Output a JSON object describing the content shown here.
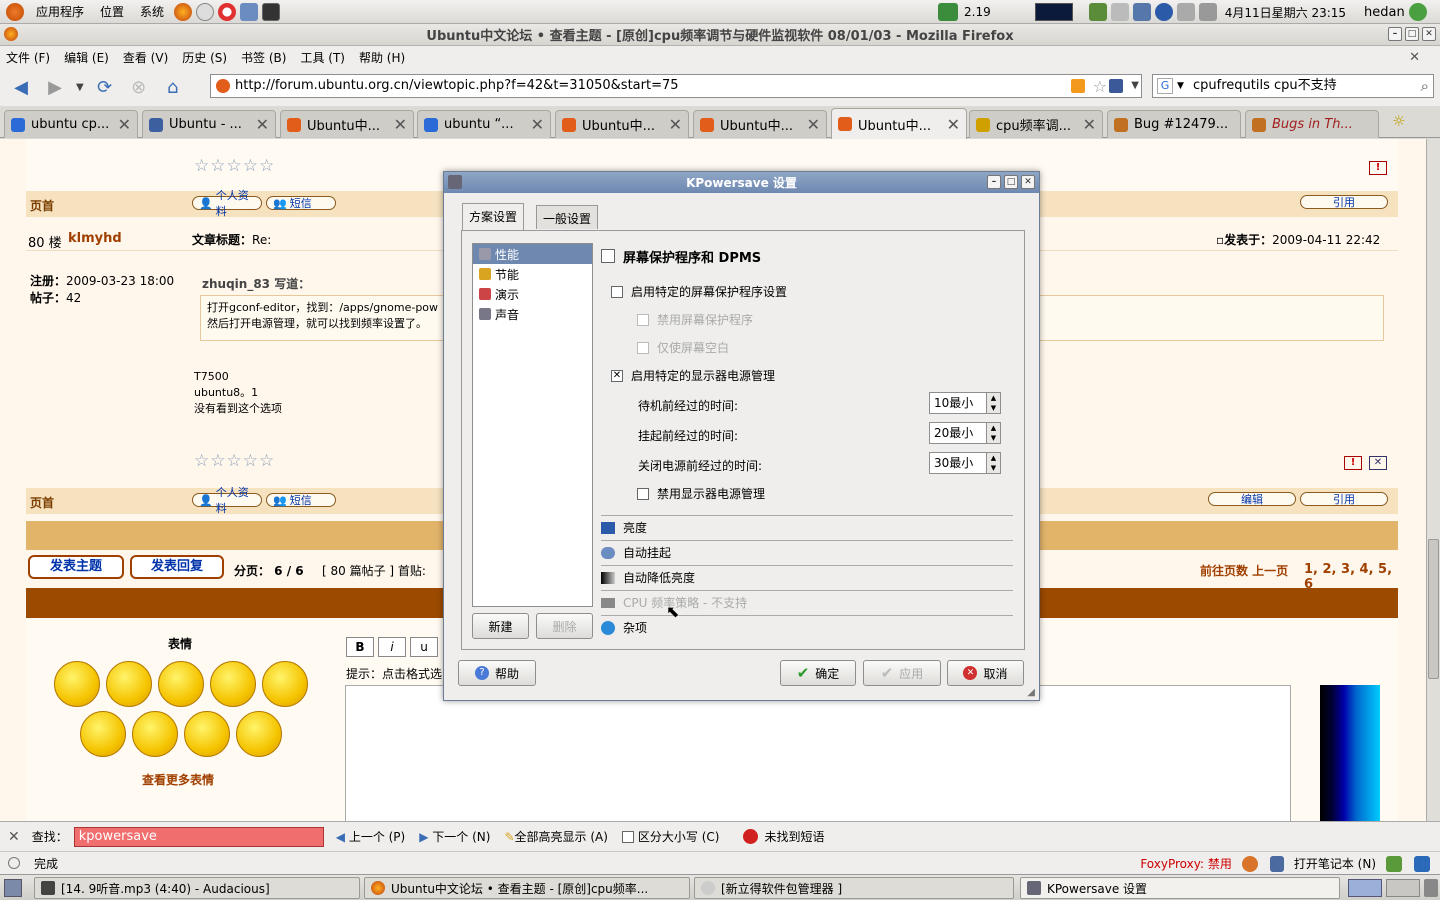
{
  "top_panel": {
    "menus": [
      "应用程序",
      "位置",
      "系统"
    ],
    "battery": "2.19",
    "clock": "4月11日星期六 23:15",
    "user": "hedan"
  },
  "firefox": {
    "title": "Ubuntu中文论坛 • 查看主题 - [原创]cpu频率调节与硬件监视软件 08/01/03 - Mozilla Firefox",
    "menu": [
      "文件 (F)",
      "编辑 (E)",
      "查看 (V)",
      "历史 (S)",
      "书签 (B)",
      "工具 (T)",
      "帮助 (H)"
    ],
    "url": "http://forum.ubuntu.org.cn/viewtopic.php?f=42&t=31050&start=75",
    "search": "cpufrequtils cpu不支持",
    "tabs": [
      {
        "label": "ubuntu cp...",
        "fav": "#2a6bd8"
      },
      {
        "label": "Ubuntu - ...",
        "fav": "#3c5fa0"
      },
      {
        "label": "Ubuntu中...",
        "fav": "#e25c1a"
      },
      {
        "label": "ubuntu “...",
        "fav": "#2a6bd8"
      },
      {
        "label": "Ubuntu中...",
        "fav": "#e25c1a"
      },
      {
        "label": "Ubuntu中...",
        "fav": "#e25c1a"
      },
      {
        "label": "Ubuntu中...",
        "fav": "#e25c1a"
      },
      {
        "label": "cpu频率调...",
        "fav": "#d0a000"
      },
      {
        "label": "Bug #12479...",
        "fav": "#c07020"
      },
      {
        "label": "Bugs in Th...",
        "fav": "#c07020"
      }
    ]
  },
  "forum": {
    "top_label": "页首",
    "profile_btn": "个人资料",
    "pm_btn": "短信",
    "quote_btn": "引用",
    "edit_btn": "编辑",
    "post_no": "80 楼",
    "author": "klmyhd",
    "subject_label": "文章标题：",
    "subject": "Re:",
    "posted_label": "发表于：",
    "posted": "2009-04-11 22:42",
    "reg_label": "注册：",
    "reg": "2009-03-23 18:00",
    "posts_label": "帖子：",
    "posts": "42",
    "quote_author": "zhuqin_83 写道：",
    "quote_line1": "打开gconf-editor，找到：/apps/gnome-pow",
    "quote_line2": "然后打开电源管理，就可以找到频率设置了。",
    "body1": "T7500",
    "body2": "ubuntu8。1",
    "body3": "没有看到这个选项",
    "new_topic": "发表主题",
    "reply": "发表回复",
    "pagination": "分页： 6 / 6",
    "post_count": "[ 80 篇帖子 ] 首贴:",
    "goto": "前往页数 上一页",
    "pages": "1, 2, 3, 4, 5, 6",
    "smilies_title": "表情",
    "more_smilies": "查看更多表情",
    "fmt_b": "B",
    "fmt_i": "i",
    "fmt_u": "u",
    "hint": "提示：点击格式选"
  },
  "dialog": {
    "title": "KPowersave 设置",
    "tabs": [
      "方案设置",
      "一般设置"
    ],
    "schemes": [
      "性能",
      "节能",
      "演示",
      "声音"
    ],
    "new_btn": "新建",
    "delete_btn": "删除",
    "section_title": "屏幕保护程序和 DPMS",
    "opt_screensaver": "启用特定的屏幕保护程序设置",
    "opt_disable_ss": "禁用屏幕保护程序",
    "opt_blank": "仅使屏幕空白",
    "opt_dpms": "启用特定的显示器电源管理",
    "standby_label": "待机前经过的时间:",
    "standby_val": "10最小",
    "suspend_label": "挂起前经过的时间:",
    "suspend_val": "20最小",
    "off_label": "关闭电源前经过的时间:",
    "off_val": "30最小",
    "opt_disable_dpms": "禁用显示器电源管理",
    "sections": [
      "亮度",
      "自动挂起",
      "自动降低亮度",
      "CPU 频率策略 - 不支持",
      "杂项"
    ],
    "help_btn": "帮助",
    "ok_btn": "确定",
    "apply_btn": "应用",
    "cancel_btn": "取消"
  },
  "findbar": {
    "label": "查找：",
    "value": "kpowersave",
    "prev": "上一个 (P)",
    "next": "下一个 (N)",
    "highlight": "全部高亮显示 (A)",
    "case": "区分大小写 (C)",
    "not_found": "未找到短语"
  },
  "status": {
    "text": "完成",
    "foxy": "FoxyProxy: 禁用",
    "notebook": "打开笔记本 (N)"
  },
  "taskbar": [
    "[14. 9听音.mp3 (4:40) - Audacious]",
    "Ubuntu中文论坛 • 查看主题 - [原创]cpu频率...",
    "[新立得软件包管理器 ]",
    "KPowersave 设置"
  ]
}
